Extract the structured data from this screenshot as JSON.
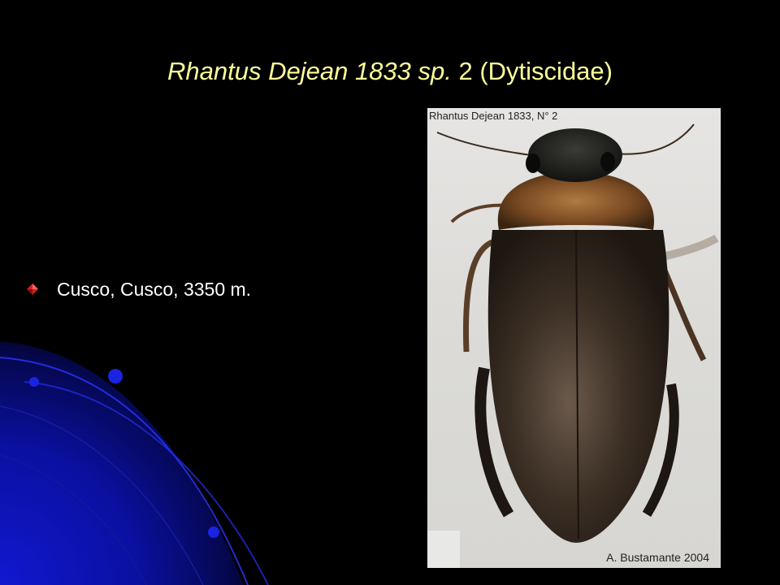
{
  "slide": {
    "title_italic": "Rhantus Dejean 1833 sp.",
    "title_rest": " 2 (Dytiscidae)",
    "bullets": [
      {
        "text": "Cusco, Cusco, 3350 m."
      }
    ]
  },
  "photo": {
    "label": "Rhantus Dejean 1833, N° 2",
    "credit": "A. Bustamante 2004"
  },
  "colors": {
    "background": "#000000",
    "title": "#ffff99",
    "bullet_text": "#ffffff",
    "bullet_icon": "#cc2222",
    "accent_blue": "#0a14c8"
  },
  "icons": {
    "bullet": "red-diamond-arrow-icon"
  }
}
